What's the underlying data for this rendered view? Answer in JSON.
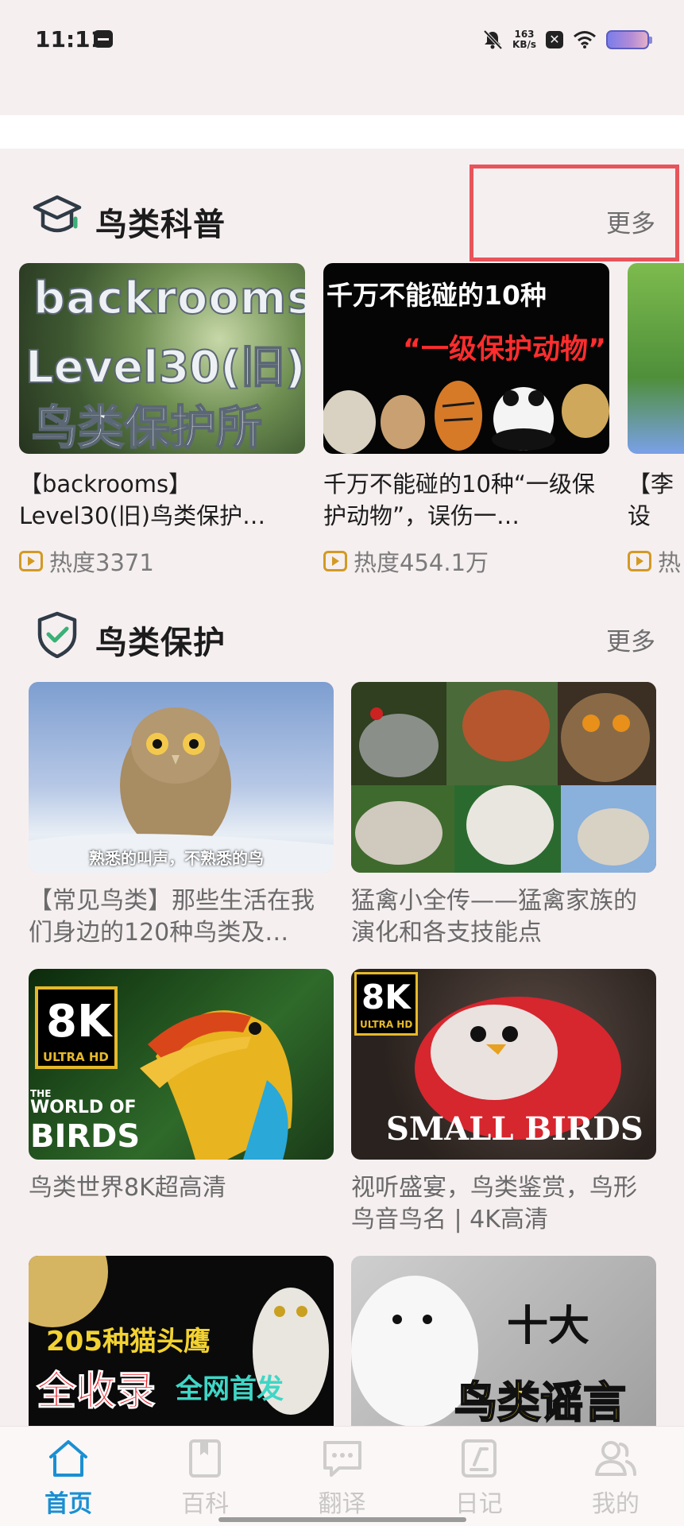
{
  "status": {
    "time": "11:11",
    "speed_top": "163",
    "speed_bottom": "KB/s",
    "x_glyph": "✕"
  },
  "section1": {
    "title": "鸟类科普",
    "more": "更多",
    "cards": [
      {
        "thumb_lines": [
          "backrooms",
          "Level30(旧)",
          "鸟类保护所"
        ],
        "title": "【backrooms】Level30(旧)鸟类保护…",
        "heat": "热度3371"
      },
      {
        "thumb_lines": [
          "千万不能碰的10种",
          "“一级保护动物”"
        ],
        "title": "千万不能碰的10种“一级保护动物”，误伤一…",
        "heat": "热度454.1万"
      },
      {
        "thumb_lines": [],
        "title": "【李 设",
        "heat": "热"
      }
    ]
  },
  "section2": {
    "title": "鸟类保护",
    "more": "更多",
    "cards": [
      {
        "title": "【常见鸟类】那些生活在我们身边的120种鸟类及…",
        "thumb_caption": "熟悉的叫声，不熟悉的鸟"
      },
      {
        "title": "猛禽小全传——猛禽家族的演化和各支技能点",
        "thumb_caption": ""
      },
      {
        "title": "鸟类世界8K超高清",
        "thumb_caption": "",
        "badge_big": "8K",
        "badge_small": "ULTRA HD",
        "thumb_sub": "THE",
        "thumb_sub2": "WORLD OF",
        "thumb_big": "BIRDS"
      },
      {
        "title": "视听盛宴，鸟类鉴赏，鸟形鸟音鸟名 | 4K高清",
        "thumb_caption": "",
        "badge_big": "8K",
        "badge_small": "ULTRA HD",
        "thumb_big": "SMALL BIRDS"
      },
      {
        "title": "",
        "thumb_line1": "205种猫头鹰",
        "thumb_line2a": "全收录",
        "thumb_line2b": "全网首发"
      },
      {
        "title": "",
        "thumb_line1": "十大",
        "thumb_line2": "鸟类谣言"
      }
    ]
  },
  "nav": {
    "items": [
      {
        "label": "首页",
        "icon": "home-icon",
        "active": true
      },
      {
        "label": "百科",
        "icon": "book-icon",
        "active": false
      },
      {
        "label": "翻译",
        "icon": "chat-icon",
        "active": false
      },
      {
        "label": "日记",
        "icon": "diary-icon",
        "active": false
      },
      {
        "label": "我的",
        "icon": "profile-icon",
        "active": false
      }
    ]
  },
  "colors": {
    "accent": "#1b8fd2",
    "highlight": "#e8545a",
    "section_icon_accent": "#3bb077"
  }
}
